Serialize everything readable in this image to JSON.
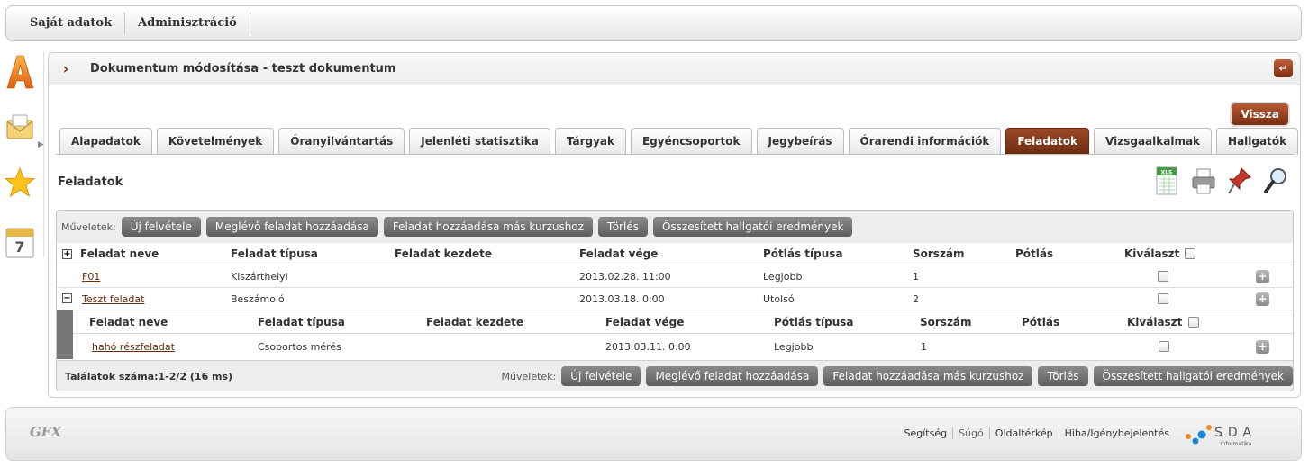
{
  "topnav": {
    "items": [
      "Saját adatok",
      "Adminisztráció"
    ]
  },
  "sidebar": {
    "icons": [
      "letter-a-icon",
      "envelope-icon",
      "star-icon",
      "calendar-icon"
    ],
    "calendar_day": "7"
  },
  "page": {
    "title": "Dokumentum módosítása - teszt dokumentum",
    "back_button": "Vissza",
    "tabs": [
      "Alapadatok",
      "Követelmények",
      "Óranyilvántartás",
      "Jelenléti statisztika",
      "Tárgyak",
      "Egyéncsoportok",
      "Jegybeírás",
      "Órarendi információk",
      "Feladatok",
      "Vizsgaalkalmak",
      "Hallgatók"
    ],
    "active_tab": "Feladatok",
    "section_title": "Feladatok",
    "tool_icons": [
      "excel-export-icon",
      "print-icon",
      "pin-icon",
      "search-icon"
    ],
    "xls_label": "XLS"
  },
  "grid": {
    "ops_label": "Műveletek:",
    "ops": [
      "Új felvétele",
      "Meglévő feladat hozzáadása",
      "Feladat hozzáadása más kurzushoz",
      "Törlés",
      "Összesített hallgatói eredmények"
    ],
    "expand_symbol": "+",
    "collapse_symbol": "−",
    "add_symbol": "+",
    "columns": [
      "Feladat neve",
      "Feladat típusa",
      "Feladat kezdete",
      "Feladat vége",
      "Pótlás típusa",
      "Sorszám",
      "Pótlás",
      "Kiválaszt"
    ],
    "rows": [
      {
        "name": "F01",
        "type": "Kiszárthelyi",
        "start": "",
        "end": "2013.02.28. 11:00",
        "makeup_type": "Legjobb",
        "order": "1",
        "makeup": ""
      },
      {
        "name": "Teszt feladat",
        "type": "Beszámoló",
        "start": "",
        "end": "2013.03.18. 0:00",
        "makeup_type": "Utolsó",
        "order": "2",
        "makeup": ""
      }
    ],
    "sub_columns": [
      "Feladat neve",
      "Feladat típusa",
      "Feladat kezdete",
      "Feladat vége",
      "Pótlás típusa",
      "Sorszám",
      "Pótlás",
      "Kiválaszt"
    ],
    "sub_rows": [
      {
        "name": "hahó részfeladat",
        "type": "Csoportos mérés",
        "start": "",
        "end": "2013.03.11. 0:00",
        "makeup_type": "Legjobb",
        "order": "1",
        "makeup": ""
      }
    ],
    "count_text": "Találatok száma:1-2/2 (16 ms)"
  },
  "footer": {
    "logo_text": "GFX",
    "links": [
      "Segítség",
      "Súgó",
      "Oldaltérkép",
      "Hiba/Igénybejelentés"
    ],
    "brand": "SDA",
    "brand_sub": "Informatika"
  }
}
